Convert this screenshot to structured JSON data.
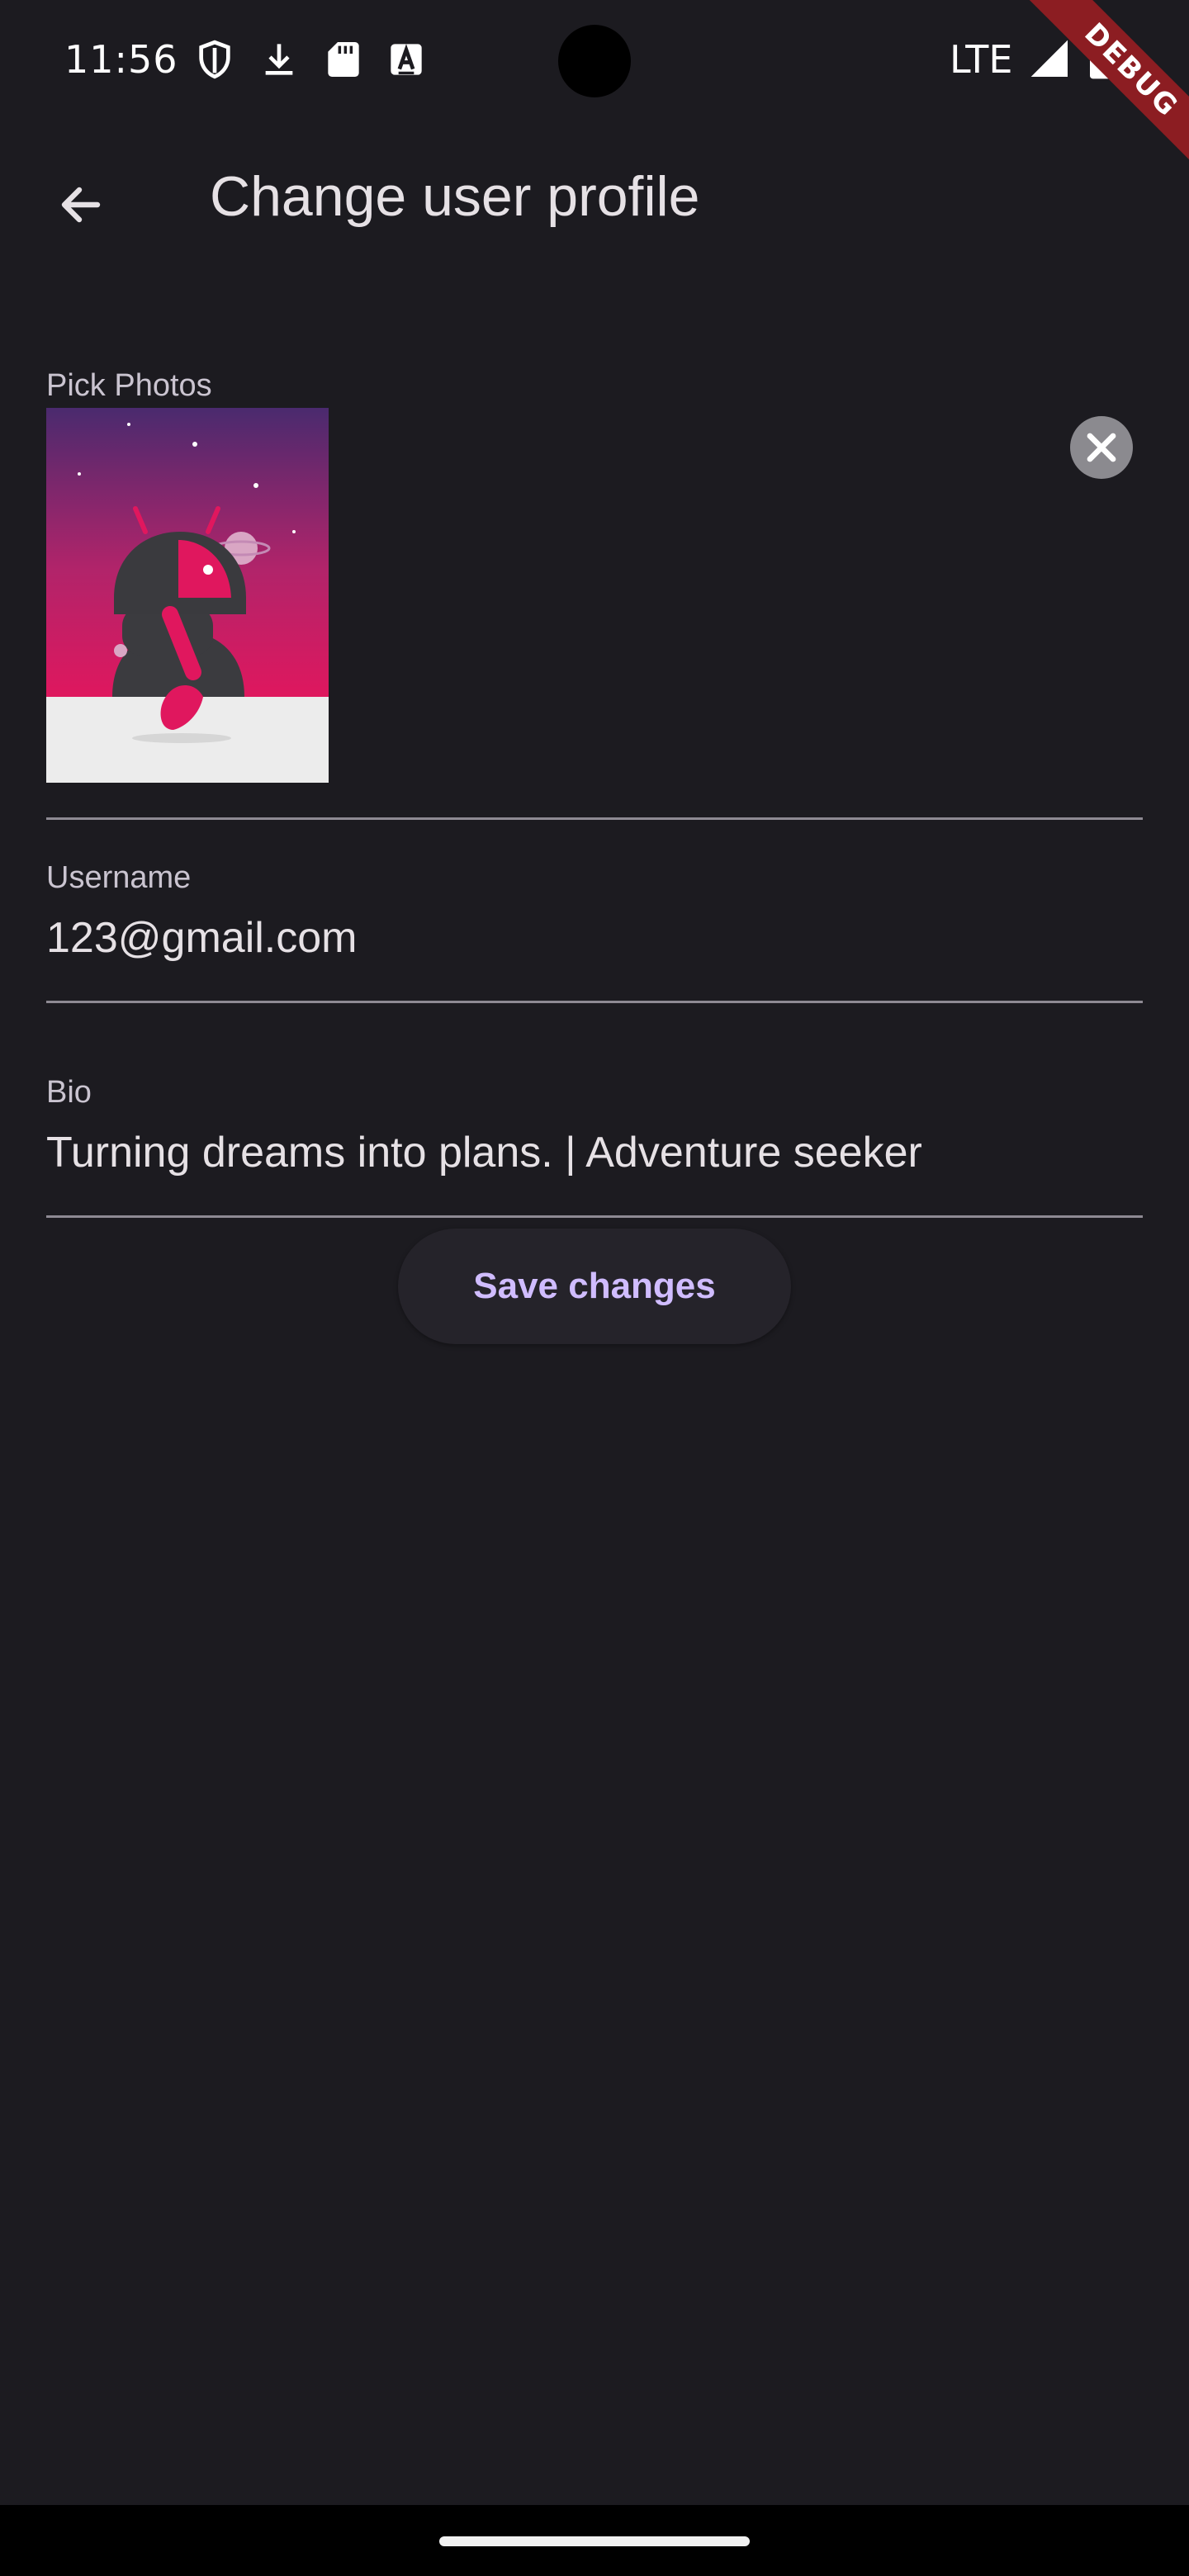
{
  "status_bar": {
    "time": "11:56",
    "network": "LTE",
    "icons": [
      "shield-icon",
      "download-icon",
      "sd-card-icon",
      "keyboard-a-icon",
      "signal-icon",
      "battery-icon"
    ]
  },
  "debug_banner": "DEBUG",
  "app_bar": {
    "title": "Change user profile",
    "back_icon": "arrow-back-icon"
  },
  "form": {
    "photos_label": "Pick Photos",
    "remove_icon": "close-icon",
    "username_label": "Username",
    "username_value": "123@gmail.com",
    "bio_label": "Bio",
    "bio_value": "Turning dreams into plans. | Adventure seeker",
    "save_label": "Save changes"
  },
  "colors": {
    "background": "#1c1b20",
    "accent": "#d0bcff",
    "ribbon": "#8c1d22"
  }
}
